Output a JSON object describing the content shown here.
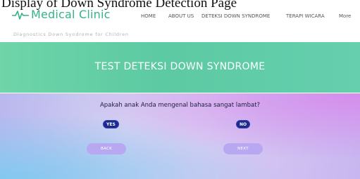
{
  "caption": "Display of Down Syndrome Detection Page",
  "header": {
    "logo_text": "Medical Clinic",
    "tagline": "Diagnostics Down Syndrome for Children",
    "nav": [
      {
        "label": "HOME"
      },
      {
        "label": "ABOUT US"
      },
      {
        "label": "DETEKSI DOWN SYNDROME"
      },
      {
        "label": "TERAPI WICARA"
      },
      {
        "label": "More"
      }
    ]
  },
  "banner": {
    "title": "TEST DETEKSI DOWN SYNDROME"
  },
  "quiz": {
    "question": "Apakah anak Anda mengenal bahasa sangat lambat?",
    "yes_label": "YES",
    "no_label": "NO",
    "back_label": "BACK",
    "next_label": "NEXT"
  },
  "colors": {
    "brand": "#34b28a",
    "banner": "#5ccaa3",
    "option_button": "#1b2a8c",
    "nav_button": "#b8a8f2"
  }
}
